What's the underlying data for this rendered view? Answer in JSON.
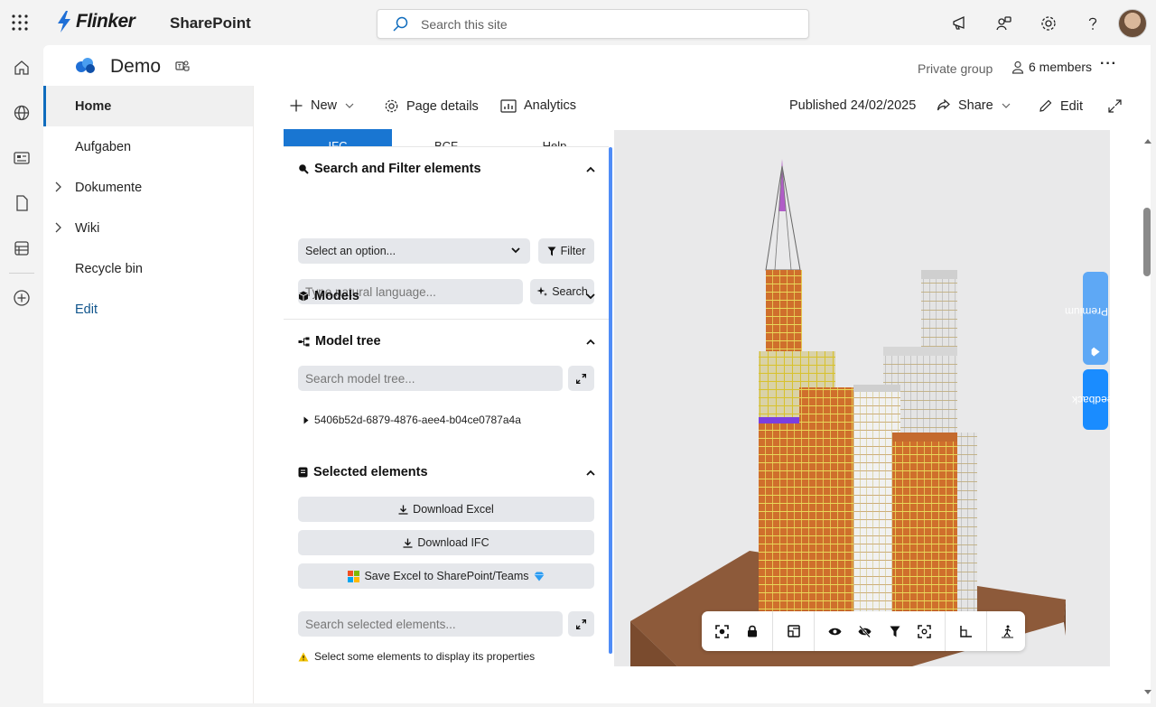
{
  "suite": {
    "brand": "Flinker",
    "app": "SharePoint",
    "search_placeholder": "Search this site"
  },
  "site": {
    "title": "Demo",
    "privacy": "Private group",
    "members": "6 members"
  },
  "nav": {
    "home": "Home",
    "aufgaben": "Aufgaben",
    "dokumente": "Dokumente",
    "wiki": "Wiki",
    "recycle": "Recycle bin",
    "edit": "Edit"
  },
  "commands": {
    "new": "New",
    "page_details": "Page details",
    "analytics": "Analytics",
    "published": "Published 24/02/2025",
    "share": "Share",
    "edit": "Edit"
  },
  "panel": {
    "tabs": [
      "IFC",
      "BCF",
      "Help"
    ],
    "search_filter": {
      "title": "Search and Filter elements",
      "select_value": "Select an option...",
      "filter_label": "Filter",
      "nl_placeholder": "Type natural language...",
      "search_label": "Search"
    },
    "models": {
      "title": "Models"
    },
    "model_tree": {
      "title": "Model tree",
      "search_placeholder": "Search model tree...",
      "node": "5406b52d-6879-4876-aee4-b04ce0787a4a"
    },
    "selected": {
      "title": "Selected elements",
      "download_excel": "Download Excel",
      "download_ifc": "Download IFC",
      "save_excel": "Save Excel to SharePoint/Teams",
      "search_placeholder": "Search selected elements...",
      "hint": "Select some elements to display its properties"
    }
  },
  "side_tabs": {
    "premium": "Try Premium",
    "feedback": "Feedback"
  },
  "colors": {
    "accent": "#1976d2",
    "nav_active": "#0f6cbd",
    "feedback": "#1a8cff",
    "premium": "#5ea8f5",
    "ground": "#8b5a3c",
    "facade": "#c8682a",
    "frame_yellow": "#d4c23a"
  }
}
